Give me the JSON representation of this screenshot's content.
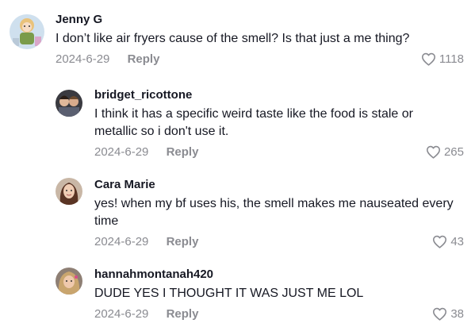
{
  "comments": [
    {
      "username": "Jenny G",
      "text": "I don’t like air fryers cause of the smell? Is that just a me thing?",
      "date": "2024-6-29",
      "reply_label": "Reply",
      "likes": "1118",
      "avatar_icon": "avatar-image"
    },
    {
      "username": "bridget_ricottone",
      "text": "I think it has a specific weird taste like the food is stale or metallic so i don't use it.",
      "date": "2024-6-29",
      "reply_label": "Reply",
      "likes": "265",
      "avatar_icon": "avatar-image"
    },
    {
      "username": "Cara Marie",
      "text": "yes! when my bf uses his, the smell makes me nauseated every time",
      "date": "2024-6-29",
      "reply_label": "Reply",
      "likes": "43",
      "avatar_icon": "avatar-image"
    },
    {
      "username": "hannahmontanah420",
      "text": "DUDE YES I THOUGHT IT WAS JUST ME LOL",
      "date": "2024-6-29",
      "reply_label": "Reply",
      "likes": "38",
      "avatar_icon": "avatar-image"
    }
  ],
  "icons": {
    "like": "heart-outline-icon"
  },
  "colors": {
    "text": "#161823",
    "muted": "#8a8b91",
    "background": "#ffffff"
  }
}
